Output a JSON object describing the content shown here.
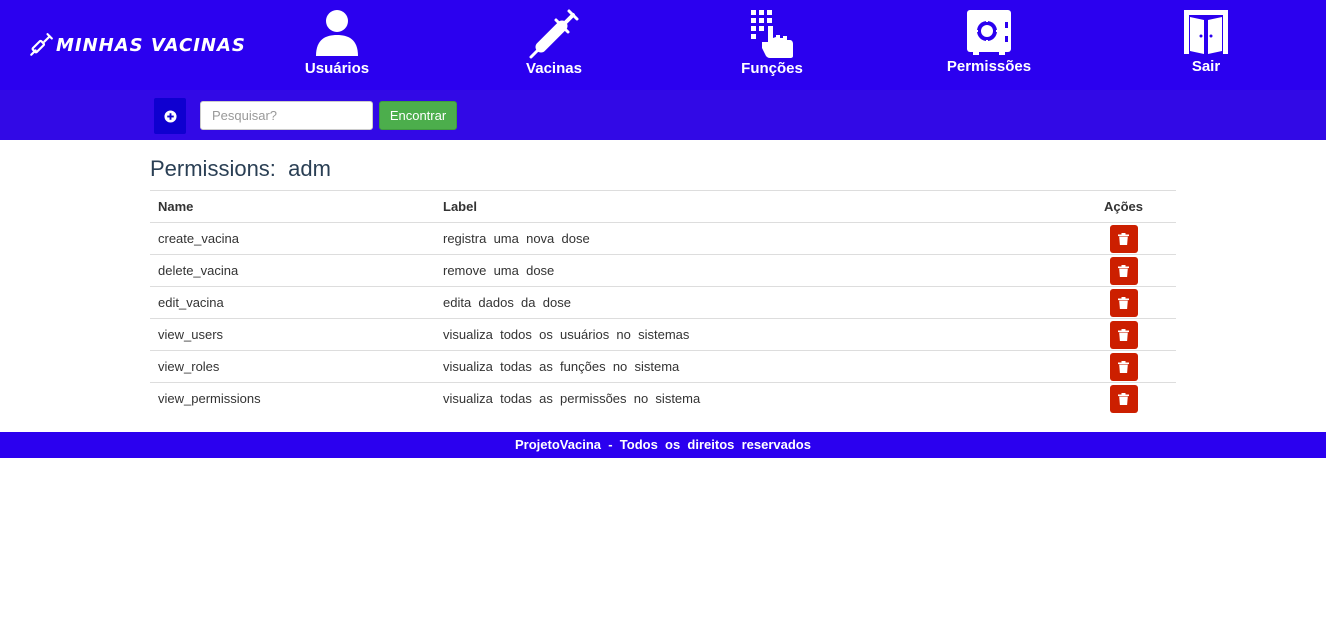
{
  "brand": {
    "name": "Minhas Vacinas"
  },
  "nav": {
    "items": [
      {
        "label": "Usuários",
        "icon": "user-icon"
      },
      {
        "label": "Vacinas",
        "icon": "syringe-icon"
      },
      {
        "label": "Funções",
        "icon": "keypad-hand-icon"
      },
      {
        "label": "Permissões",
        "icon": "safe-icon"
      },
      {
        "label": "Sair",
        "icon": "door-icon"
      }
    ]
  },
  "toolbar": {
    "add_icon": "plus-circle-icon",
    "search_placeholder": "Pesquisar?",
    "search_value": "",
    "find_label": "Encontrar"
  },
  "page": {
    "title": "Permissions:  adm"
  },
  "table": {
    "headers": {
      "name": "Name",
      "label": "Label",
      "actions": "Ações"
    },
    "rows": [
      {
        "name": "create_vacina",
        "label": "registra  uma  nova  dose"
      },
      {
        "name": "delete_vacina",
        "label": "remove  uma  dose"
      },
      {
        "name": "edit_vacina",
        "label": "edita  dados  da  dose"
      },
      {
        "name": "view_users",
        "label": "visualiza  todos  os  usuários  no  sistemas"
      },
      {
        "name": "view_roles",
        "label": "visualiza  todas  as  funções  no  sistema"
      },
      {
        "name": "view_permissions",
        "label": "visualiza  todas  as  permissões  no  sistema"
      }
    ],
    "delete_icon": "trash-icon"
  },
  "footer": {
    "text": "ProjetoVacina  -  Todos  os  direitos  reservados"
  },
  "colors": {
    "primary": "#2b00ef",
    "subbar": "#3209e6",
    "success": "#4cae4c",
    "danger": "#cc1f00"
  }
}
